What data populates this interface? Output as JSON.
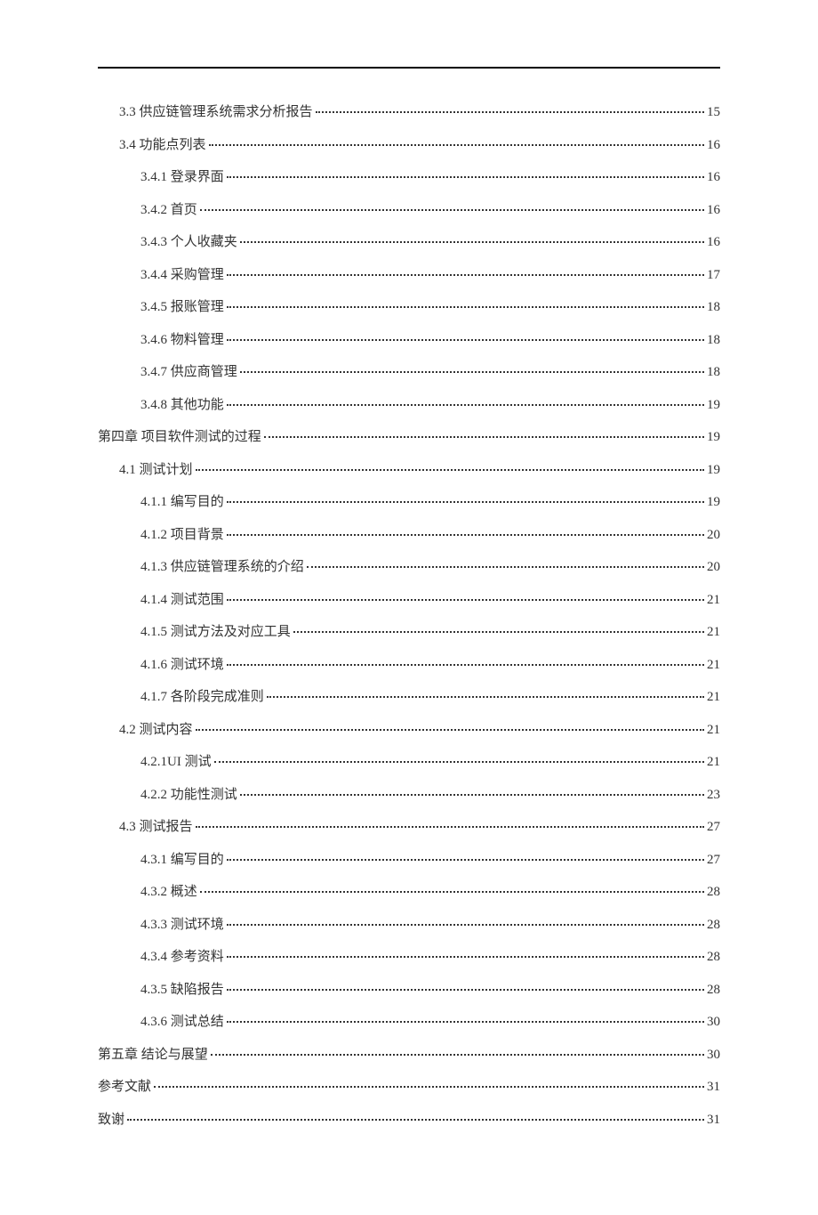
{
  "toc": [
    {
      "label": "3.3 供应链管理系统需求分析报告",
      "page": "15",
      "indent": 1
    },
    {
      "label": "3.4 功能点列表",
      "page": "16",
      "indent": 1
    },
    {
      "label": "3.4.1 登录界面",
      "page": "16",
      "indent": 2
    },
    {
      "label": "3.4.2 首页",
      "page": "16",
      "indent": 2
    },
    {
      "label": "3.4.3 个人收藏夹",
      "page": "16",
      "indent": 2
    },
    {
      "label": "3.4.4 采购管理",
      "page": "17",
      "indent": 2
    },
    {
      "label": "3.4.5 报账管理",
      "page": "18",
      "indent": 2
    },
    {
      "label": "3.4.6 物料管理",
      "page": "18",
      "indent": 2
    },
    {
      "label": "3.4.7 供应商管理",
      "page": "18",
      "indent": 2
    },
    {
      "label": "3.4.8 其他功能",
      "page": "19",
      "indent": 2
    },
    {
      "label": "第四章  项目软件测试的过程",
      "page": "19",
      "indent": 0
    },
    {
      "label": "4.1 测试计划",
      "page": "19",
      "indent": 1
    },
    {
      "label": "4.1.1 编写目的",
      "page": "19",
      "indent": 2
    },
    {
      "label": "4.1.2 项目背景",
      "page": "20",
      "indent": 2
    },
    {
      "label": "4.1.3 供应链管理系统的介绍",
      "page": "20",
      "indent": 2
    },
    {
      "label": "4.1.4 测试范围",
      "page": "21",
      "indent": 2
    },
    {
      "label": "4.1.5 测试方法及对应工具",
      "page": "21",
      "indent": 2
    },
    {
      "label": "4.1.6 测试环境",
      "page": "21",
      "indent": 2
    },
    {
      "label": "4.1.7 各阶段完成准则",
      "page": "21",
      "indent": 2
    },
    {
      "label": "4.2 测试内容",
      "page": "21",
      "indent": 1
    },
    {
      "label": "4.2.1UI 测试",
      "page": "21",
      "indent": 2
    },
    {
      "label": "4.2.2 功能性测试",
      "page": "23",
      "indent": 2
    },
    {
      "label": "4.3 测试报告",
      "page": "27",
      "indent": 1
    },
    {
      "label": "4.3.1 编写目的",
      "page": "27",
      "indent": 2
    },
    {
      "label": "4.3.2 概述",
      "page": "28",
      "indent": 2
    },
    {
      "label": "4.3.3 测试环境",
      "page": "28",
      "indent": 2
    },
    {
      "label": "4.3.4 参考资料",
      "page": "28",
      "indent": 2
    },
    {
      "label": "4.3.5 缺陷报告",
      "page": "28",
      "indent": 2
    },
    {
      "label": "4.3.6 测试总结",
      "page": "30",
      "indent": 2
    },
    {
      "label": "第五章  结论与展望",
      "page": "30",
      "indent": 0
    },
    {
      "label": "参考文献",
      "page": "31",
      "indent": 0
    },
    {
      "label": "致谢",
      "page": "31",
      "indent": 0
    }
  ]
}
